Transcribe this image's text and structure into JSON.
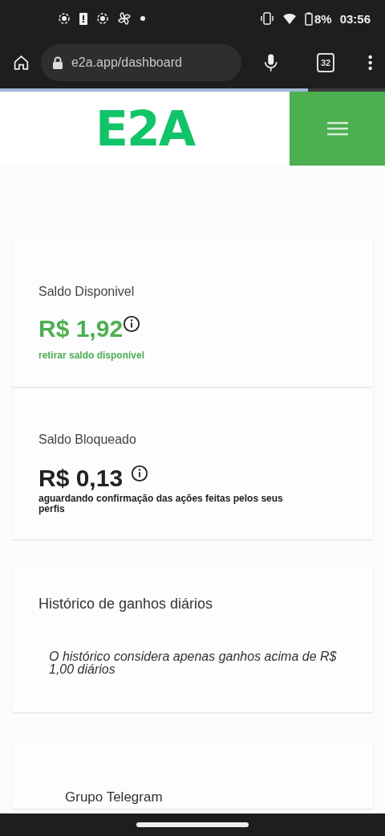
{
  "status_bar": {
    "battery": "8%",
    "time": "03:56"
  },
  "browser": {
    "url": "e2a.app/dashboard",
    "tab_count": "32",
    "load_progress": {
      "level": 0.8
    }
  },
  "header": {
    "logo": "E2A"
  },
  "balances": [
    {
      "kind": "available",
      "title": "Saldo Disponivel",
      "amount": "R$ 1,92",
      "note": "retirar saldo disponível"
    },
    {
      "kind": "blocked",
      "title": "Saldo Bloqueado",
      "amount": "R$ 0,13",
      "note": "aguardando confirmação das ações feitas pelos seus perfis"
    }
  ],
  "history": {
    "title": "Histórico de ganhos diários",
    "note": "O histórico considera apenas ganhos acima de R$ 1,00 diários"
  },
  "telegram": {
    "title": "Grupo Telegram"
  }
}
